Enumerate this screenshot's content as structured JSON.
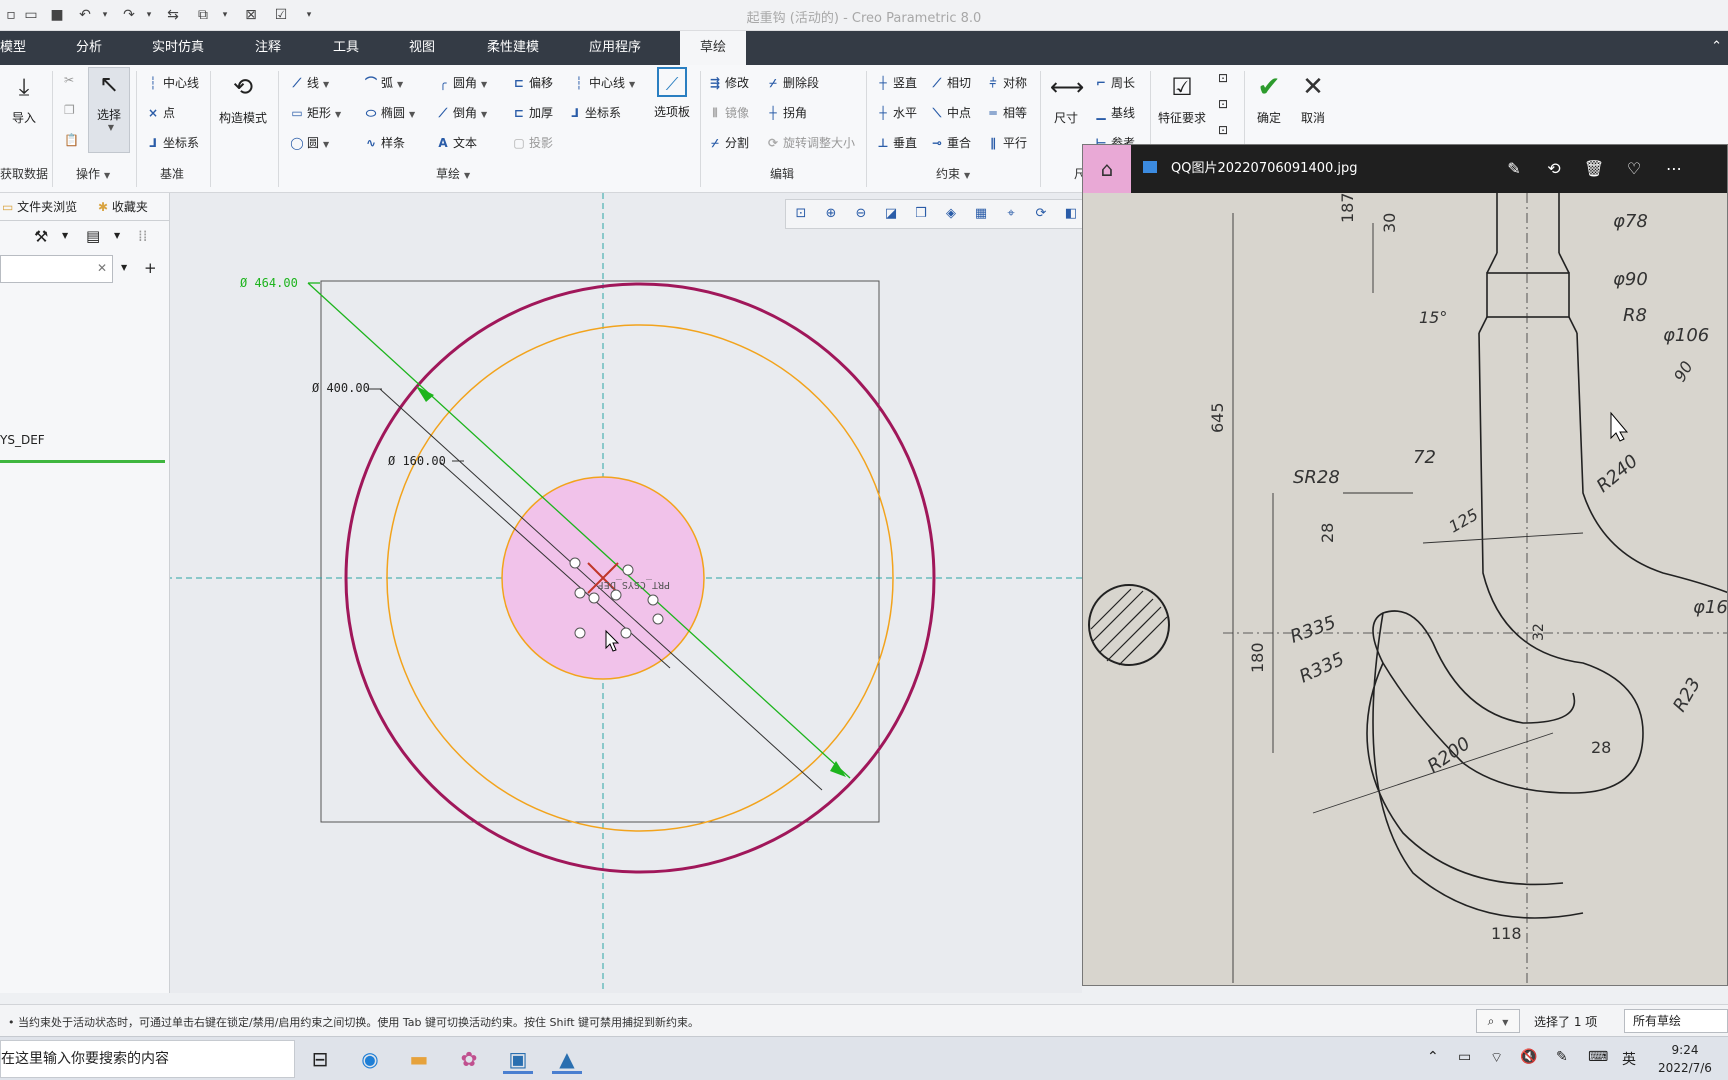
{
  "window": {
    "title": "起重钩 (活动的) - Creo Parametric 8.0"
  },
  "tabs": [
    {
      "label": "模型"
    },
    {
      "label": "分析"
    },
    {
      "label": "实时仿真"
    },
    {
      "label": "注释"
    },
    {
      "label": "工具"
    },
    {
      "label": "视图"
    },
    {
      "label": "柔性建模"
    },
    {
      "label": "应用程序"
    },
    {
      "label": "草绘"
    }
  ],
  "ribbon": {
    "get_data": {
      "import": "导入",
      "group": "获取数据"
    },
    "operations": {
      "select": "选择",
      "group": "操作"
    },
    "datum": {
      "centerline": "中心线",
      "point": "点",
      "csys": "坐标系",
      "group": "基准"
    },
    "construction": {
      "mode": "构造模式"
    },
    "sketching": {
      "line": "线",
      "arc": "弧",
      "fillet": "圆角",
      "offset": "偏移",
      "centerline": "中心线",
      "rectangle": "矩形",
      "ellipse": "椭圆",
      "chamfer": "倒角",
      "thicken": "加厚",
      "csys": "坐标系",
      "circle": "圆",
      "spline": "样条",
      "text": "文本",
      "project": "投影",
      "palette": "选项板",
      "group": "草绘"
    },
    "editing": {
      "modify": "修改",
      "delete_segment": "删除段",
      "mirror": "镜像",
      "corner": "拐角",
      "divide": "分割",
      "rotate_resize": "旋转调整大小",
      "group": "编辑"
    },
    "constrain": {
      "vertical": "竖直",
      "tangent": "相切",
      "symmetric": "对称",
      "horizontal": "水平",
      "midpoint": "中点",
      "equal": "相等",
      "perpendicular": "垂直",
      "coincident": "重合",
      "parallel": "平行",
      "group": "约束"
    },
    "dimension": {
      "dimension": "尺寸",
      "perimeter": "周长",
      "baseline": "基线",
      "reference": "参考",
      "group_short": "尺"
    },
    "inspect": {
      "feature_requirements": "特征要求"
    },
    "close": {
      "ok": "确定",
      "cancel": "取消"
    }
  },
  "left_panel": {
    "tab_folder": "文件夹浏览",
    "tab_favorites": "收藏夹",
    "tree_item": "YS_DEF"
  },
  "sketch": {
    "dims": [
      {
        "text": "Ø 464.00"
      },
      {
        "text": "Ø 400.00"
      },
      {
        "text": "Ø 160.00"
      }
    ],
    "csys_label": "PRT_CSYS_DEF",
    "colors": {
      "outer": "#a0175a",
      "mid": "#f2a31c",
      "fill": "#f1c2ea",
      "dim": "#1db41d",
      "axis": "#2aa6a6"
    }
  },
  "viewer": {
    "filename": "QQ图片20220706091400.jpg",
    "drawing_labels": [
      "187",
      "30",
      "φ78",
      "φ90",
      "15°",
      "R8",
      "φ106",
      "645",
      "90",
      "SR28",
      "72",
      "R240",
      "125",
      "28",
      "φ16",
      "32",
      "180",
      "R335",
      "R335",
      "R200",
      "28",
      "R23",
      "118"
    ]
  },
  "status": {
    "message": "• 当约束处于活动状态时，可通过单击右键在锁定/禁用/启用约束之间切换。使用 Tab 键可切换活动约束。按住 Shift 键可禁用捕捉到新约束。",
    "selected": "选择了 1 项",
    "filter": "所有草绘"
  },
  "taskbar": {
    "search_placeholder": "在这里输入你要搜索的内容",
    "ime": "英",
    "time": "9:24",
    "date": "2022/7/6"
  }
}
